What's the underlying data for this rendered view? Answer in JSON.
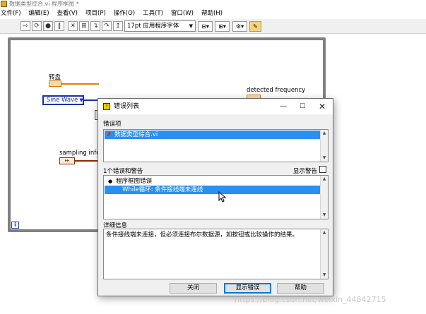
{
  "window": {
    "title": "数据类型综合.vi 程序框图 *"
  },
  "menu": [
    "文件(F)",
    "编辑(E)",
    "查看(V)",
    "项目(P)",
    "操作(O)",
    "工具(T)",
    "窗口(W)",
    "帮助(H)"
  ],
  "toolbar": {
    "font_select": "17pt 应用程序字体"
  },
  "diagram": {
    "knob_label": "转盘",
    "enum_value": "Sine Wave",
    "sampling_label": "sampling info",
    "detected_label": "detected frequency",
    "loop_iteration": "i"
  },
  "dialog": {
    "title": "错误列表",
    "errors_section_label": "错误项",
    "error_items": [
      "数据类型综合.vi"
    ],
    "count_label": "1个错误和警告",
    "show_warnings_label": "显示警告",
    "warnings_group": "程序框图错误",
    "warnings_item": "While循环: 条件接线端未连线",
    "details_label": "详细信息",
    "details_text": "条件接线端未连接，但必须连接布尔数据源，如按钮或比较操作的结果。",
    "buttons": {
      "close": "关闭",
      "show_error": "显示错误",
      "help": "帮助"
    }
  },
  "watermark": "https://blog.csdn.net/weixin_44842715",
  "colors": {
    "selection": "#2a90ef",
    "enum_blue": "#1b2fb0",
    "numeric_orange": "#d07a00",
    "loop_gray": "#7f7f7f"
  }
}
